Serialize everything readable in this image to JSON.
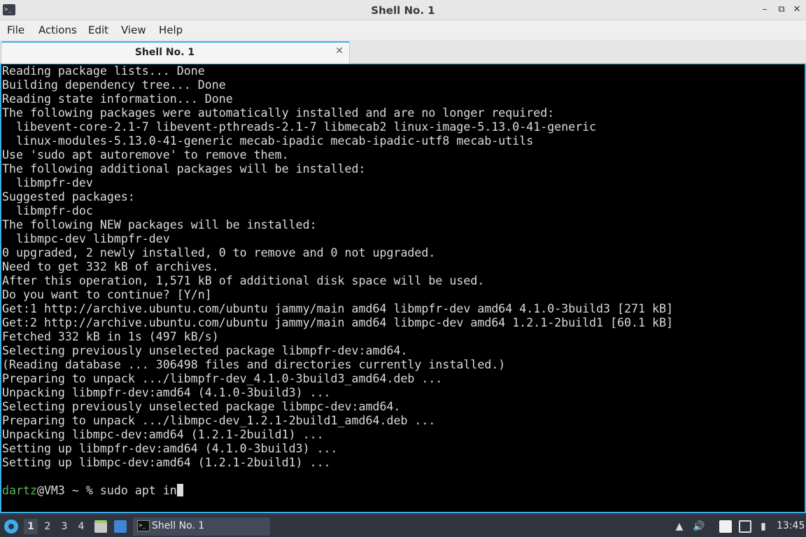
{
  "window": {
    "title": "Shell No. 1",
    "controls": {
      "minimize": "–",
      "maximize": "⧉",
      "close": "✕"
    }
  },
  "menu": [
    "File",
    "Actions",
    "Edit",
    "View",
    "Help"
  ],
  "tabs": [
    {
      "label": "Shell No. 1",
      "close": "✕"
    }
  ],
  "terminal": {
    "lines": [
      "Reading package lists... Done",
      "Building dependency tree... Done",
      "Reading state information... Done",
      "The following packages were automatically installed and are no longer required:",
      "  libevent-core-2.1-7 libevent-pthreads-2.1-7 libmecab2 linux-image-5.13.0-41-generic",
      "  linux-modules-5.13.0-41-generic mecab-ipadic mecab-ipadic-utf8 mecab-utils",
      "Use 'sudo apt autoremove' to remove them.",
      "The following additional packages will be installed:",
      "  libmpfr-dev",
      "Suggested packages:",
      "  libmpfr-doc",
      "The following NEW packages will be installed:",
      "  libmpc-dev libmpfr-dev",
      "0 upgraded, 2 newly installed, 0 to remove and 0 not upgraded.",
      "Need to get 332 kB of archives.",
      "After this operation, 1,571 kB of additional disk space will be used.",
      "Do you want to continue? [Y/n]",
      "Get:1 http://archive.ubuntu.com/ubuntu jammy/main amd64 libmpfr-dev amd64 4.1.0-3build3 [271 kB]",
      "Get:2 http://archive.ubuntu.com/ubuntu jammy/main amd64 libmpc-dev amd64 1.2.1-2build1 [60.1 kB]",
      "Fetched 332 kB in 1s (497 kB/s)",
      "Selecting previously unselected package libmpfr-dev:amd64.",
      "(Reading database ... 306498 files and directories currently installed.)",
      "Preparing to unpack .../libmpfr-dev_4.1.0-3build3_amd64.deb ...",
      "Unpacking libmpfr-dev:amd64 (4.1.0-3build3) ...",
      "Selecting previously unselected package libmpc-dev:amd64.",
      "Preparing to unpack .../libmpc-dev_1.2.1-2build1_amd64.deb ...",
      "Unpacking libmpc-dev:amd64 (1.2.1-2build1) ...",
      "Setting up libmpfr-dev:amd64 (4.1.0-3build3) ...",
      "Setting up libmpc-dev:amd64 (1.2.1-2build1) ...",
      ""
    ],
    "prompt": {
      "user": "dartz",
      "rest": "@VM3 ~ % ",
      "command": "sudo apt in"
    }
  },
  "taskbar": {
    "desktops": [
      "1",
      "2",
      "3",
      "4"
    ],
    "active_desktop": "1",
    "task": {
      "label": "Shell No. 1"
    },
    "clock": "13:45"
  },
  "colors": {
    "accent": "#3daee9",
    "prompt_user": "#5bb85b",
    "terminal_bg": "#000000",
    "panel_bg": "#2f343f"
  }
}
